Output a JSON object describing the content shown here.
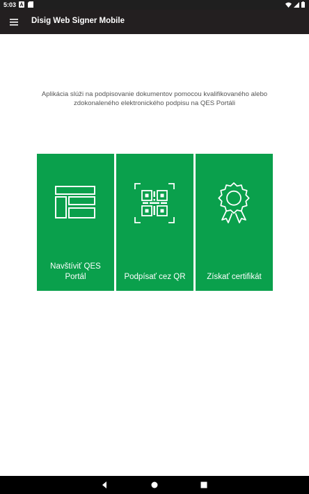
{
  "status_bar": {
    "time": "5:03",
    "left_icons": [
      "notification-a-icon",
      "sd-card-icon"
    ],
    "right_icons": [
      "wifi-icon",
      "cell-signal-icon",
      "battery-icon"
    ]
  },
  "app_bar": {
    "menu_icon": "hamburger-menu-icon",
    "title": "Disig Web Signer Mobile"
  },
  "main": {
    "description": "Aplikácia slúži na podpisovanie dokumentov pomocou kvalifikovaného alebo zdokonaleného elektronického podpisu na QES Portáli",
    "tiles": [
      {
        "label": "Navštíviť QES Portál",
        "icon": "portal-layout-icon"
      },
      {
        "label": "Podpísať cez QR",
        "icon": "qr-code-scan-icon"
      },
      {
        "label": "Získať certifikát",
        "icon": "certificate-ribbon-icon"
      }
    ]
  },
  "nav_bar": {
    "buttons": [
      "back-icon",
      "home-icon",
      "recents-icon"
    ]
  },
  "colors": {
    "tile_background": "#0aa04c",
    "app_bar": "#231f20",
    "status_bar": "#1f1f1f",
    "description_text": "#555555"
  }
}
